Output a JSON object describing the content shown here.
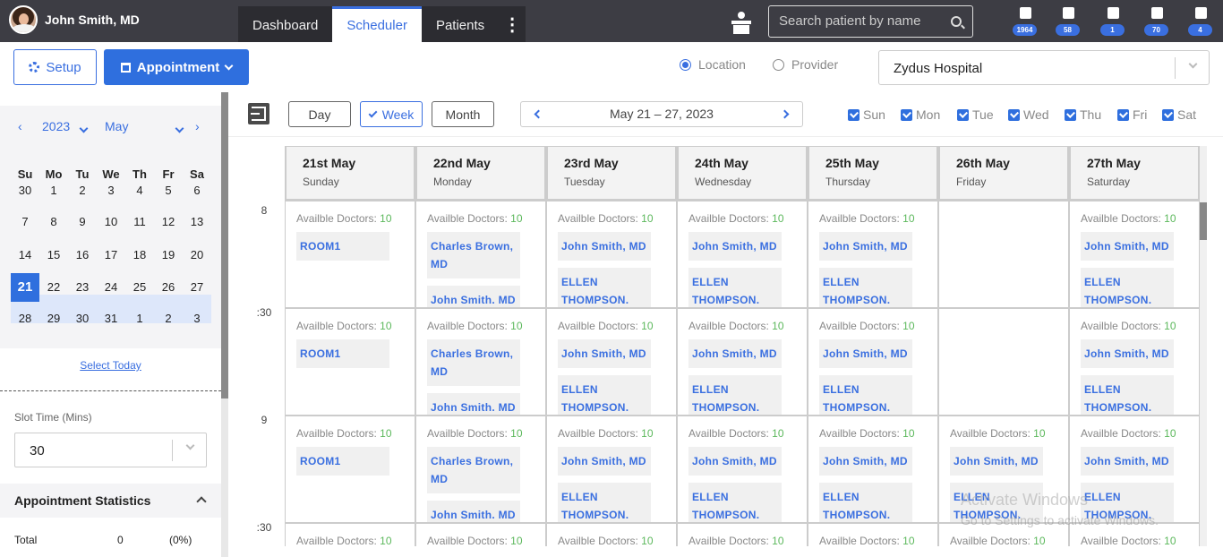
{
  "user": {
    "name": "John Smith, MD"
  },
  "nav": {
    "tabs": [
      "Dashboard",
      "Scheduler",
      "Patients"
    ],
    "active": "Scheduler"
  },
  "search": {
    "placeholder": "Search patient by name"
  },
  "toolbar": {
    "badges": [
      "1964",
      "58",
      "1",
      "70",
      "4"
    ]
  },
  "actions": {
    "setup_label": "Setup",
    "appointment_label": "Appointment"
  },
  "view_mode": {
    "location_label": "Location",
    "provider_label": "Provider",
    "selected": "Location"
  },
  "location": {
    "selected": "Zydus Hospital"
  },
  "mini_calendar": {
    "year": "2023",
    "month": "May",
    "weekdays": [
      "Su",
      "Mo",
      "Tu",
      "We",
      "Th",
      "Fr",
      "Sa"
    ],
    "weeks": [
      [
        "30",
        "1",
        "2",
        "3",
        "4",
        "5",
        "6"
      ],
      [
        "7",
        "8",
        "9",
        "10",
        "11",
        "12",
        "13"
      ],
      [
        "14",
        "15",
        "16",
        "17",
        "18",
        "19",
        "20"
      ],
      [
        "21",
        "22",
        "23",
        "24",
        "25",
        "26",
        "27"
      ],
      [
        "28",
        "29",
        "30",
        "31",
        "1",
        "2",
        "3"
      ]
    ],
    "selected_day": "21",
    "select_today_label": "Select Today"
  },
  "slot_time": {
    "label": "Slot Time (Mins)",
    "value": "30"
  },
  "stats": {
    "title": "Appointment Statistics",
    "total_label": "Total",
    "total_count": "0",
    "total_pct": "(0%)"
  },
  "calendar_view": {
    "buttons": [
      "Day",
      "Week",
      "Month"
    ],
    "active": "Week",
    "range_label": "May 21 – 27, 2023"
  },
  "day_filters": [
    "Sun",
    "Mon",
    "Tue",
    "Wed",
    "Thu",
    "Fri",
    "Sat"
  ],
  "days": [
    {
      "date": "21st May",
      "weekday": "Sunday"
    },
    {
      "date": "22nd May",
      "weekday": "Monday"
    },
    {
      "date": "23rd May",
      "weekday": "Tuesday"
    },
    {
      "date": "24th May",
      "weekday": "Wednesday"
    },
    {
      "date": "25th May",
      "weekday": "Thursday"
    },
    {
      "date": "26th May",
      "weekday": "Friday"
    },
    {
      "date": "27th May",
      "weekday": "Saturday"
    }
  ],
  "time_labels": [
    "8",
    ":30",
    "9",
    ":30"
  ],
  "slot_text": {
    "avail_label": "Availble Doctors: ",
    "avail_count": "10"
  },
  "resources": {
    "room1": "ROOM1",
    "charles": "Charles Brown, MD",
    "john": "John Smith, MD",
    "john_cut": "John Smith. MD",
    "ellen": "ELLEN THOMPSON."
  },
  "watermark": {
    "line1": "Activate Windows",
    "line2": "Go to Settings to activate Windows."
  }
}
